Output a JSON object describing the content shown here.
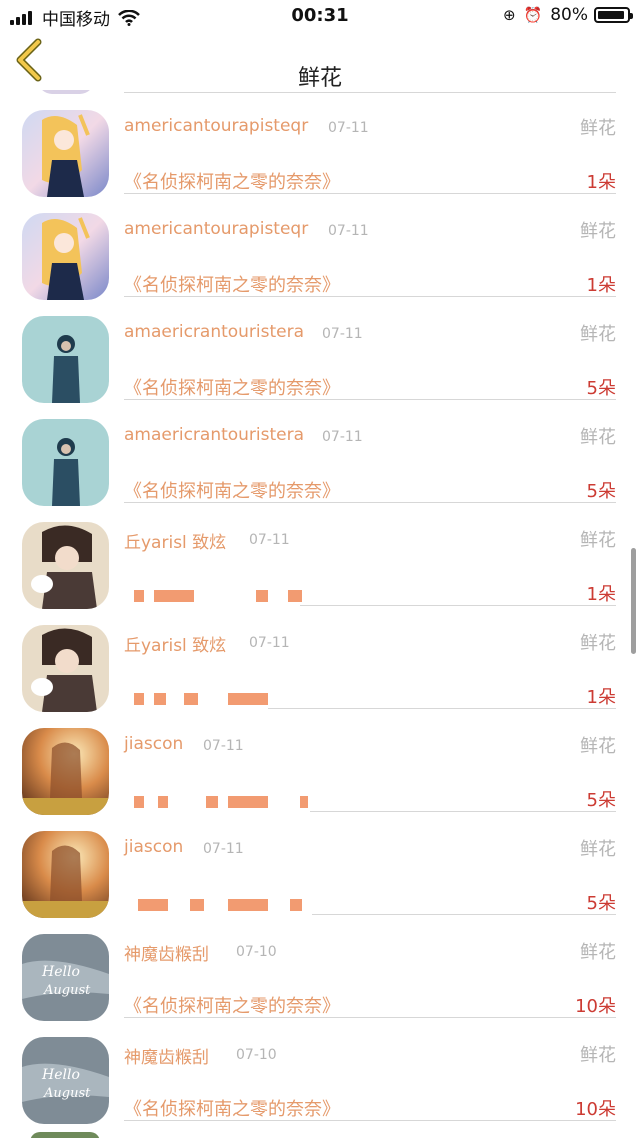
{
  "status_bar": {
    "carrier": "中国移动",
    "time": "00:31",
    "battery": "80%"
  },
  "nav": {
    "title": "鲜花"
  },
  "colors": {
    "username": "#e59a6b",
    "amount": "#cc3b33",
    "muted": "#b5b5b5"
  },
  "rows": [
    {
      "user": "americantourapisteqr",
      "date": "07-11",
      "gift": "鲜花",
      "work": "《名侦探柯南之零的奈奈》",
      "amount": "1朵",
      "avatar": "anime-girl-avatar"
    },
    {
      "user": "americantourapisteqr",
      "date": "07-11",
      "gift": "鲜花",
      "work": "《名侦探柯南之零的奈奈》",
      "amount": "1朵",
      "avatar": "anime-girl-avatar"
    },
    {
      "user": "amaericrantouristera",
      "date": "07-11",
      "gift": "鲜花",
      "work": "《名侦探柯南之零的奈奈》",
      "amount": "5朵",
      "avatar": "teal-boy-avatar"
    },
    {
      "user": "amaericrantouristera",
      "date": "07-11",
      "gift": "鲜花",
      "work": "《名侦探柯南之零的奈奈》",
      "amount": "5朵",
      "avatar": "teal-boy-avatar"
    },
    {
      "user": "丘yarisl 致炫",
      "date": "07-11",
      "gift": "鲜花",
      "work": "",
      "amount": "1朵",
      "avatar": "boy-with-cat-avatar"
    },
    {
      "user": "丘yarisl 致炫",
      "date": "07-11",
      "gift": "鲜花",
      "work": "",
      "amount": "1朵",
      "avatar": "boy-with-cat-avatar"
    },
    {
      "user": "jiascon",
      "date": "07-11",
      "gift": "鲜花",
      "work": "",
      "amount": "5朵",
      "avatar": "sunset-portrait-avatar"
    },
    {
      "user": "jiascon",
      "date": "07-11",
      "gift": "鲜花",
      "work": "",
      "amount": "5朵",
      "avatar": "sunset-portrait-avatar"
    },
    {
      "user": "神魔齿糇刮",
      "date": "07-10",
      "gift": "鲜花",
      "work": "《名侦探柯南之零的奈奈》",
      "amount": "10朵",
      "avatar": "hello-august-avatar"
    },
    {
      "user": "神魔齿糇刮",
      "date": "07-10",
      "gift": "鲜花",
      "work": "《名侦探柯南之零的奈奈》",
      "amount": "10朵",
      "avatar": "hello-august-avatar"
    }
  ]
}
